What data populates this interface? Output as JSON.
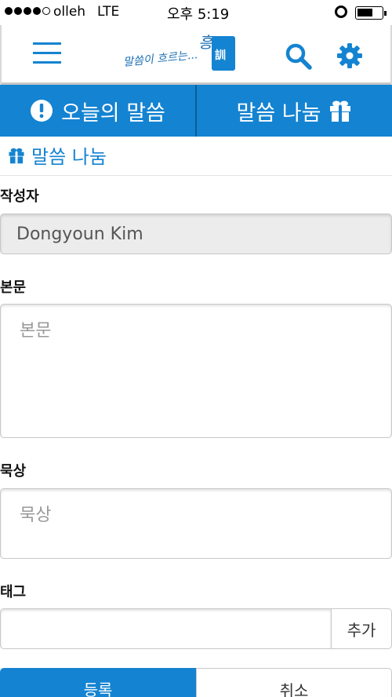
{
  "status_bar": {
    "carrier": "olleh",
    "network": "LTE",
    "time": "오후 5:19"
  },
  "header": {
    "logo_text": "말씀이 흐르는...",
    "logo_script": "흥",
    "logo_book_mark": "訓",
    "icons": [
      "hamburger-menu-icon",
      "search-icon",
      "gear-icon"
    ]
  },
  "tabs": [
    {
      "label": "오늘의 말씀",
      "icon": "exclamation-circle-icon"
    },
    {
      "label": "말씀 나눔",
      "icon": "gift-icon"
    }
  ],
  "page": {
    "title": "말씀 나눔",
    "title_icon": "gift-icon"
  },
  "form": {
    "author_label": "작성자",
    "author_value": "Dongyoun Kim",
    "body_label": "본문",
    "body_placeholder": "본문",
    "meditation_label": "묵상",
    "meditation_placeholder": "묵상",
    "tag_label": "태그",
    "tag_value": "",
    "tag_add_label": "추가",
    "submit_label": "등록",
    "cancel_label": "취소"
  },
  "colors": {
    "accent": "#1483d1",
    "readonly_bg": "#ececec",
    "border": "#c8c8c8"
  }
}
